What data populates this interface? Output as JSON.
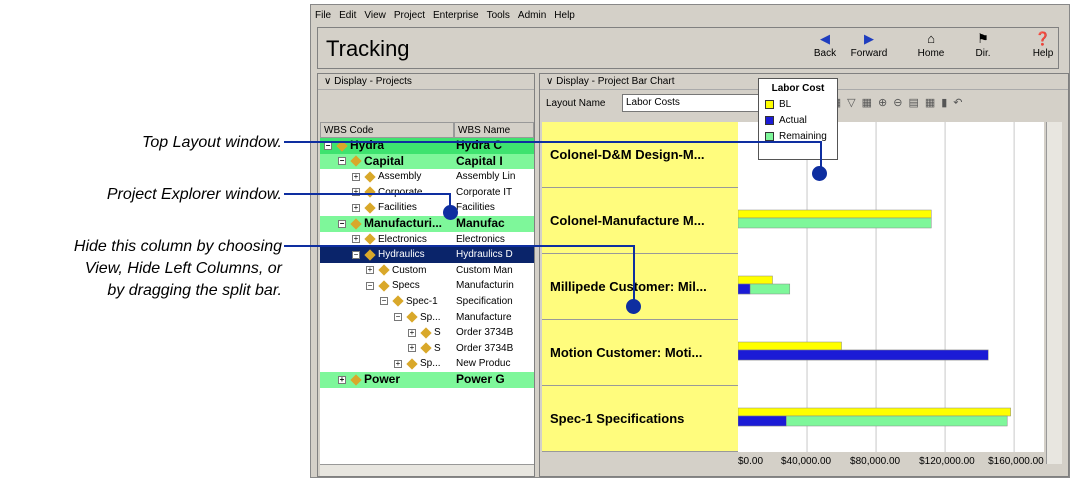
{
  "callouts": {
    "top_layout": "Top Layout window.",
    "project_explorer": "Project Explorer window.",
    "hide_line1": "Hide this column by choosing",
    "hide_line2": "View, Hide Left Columns, or",
    "hide_line3": "by dragging the split bar."
  },
  "menu": [
    "File",
    "Edit",
    "View",
    "Project",
    "Enterprise",
    "Tools",
    "Admin",
    "Help"
  ],
  "window_title": "Tracking",
  "toolbar": {
    "back": "Back",
    "forward": "Forward",
    "home": "Home",
    "dir": "Dir.",
    "help": "Help"
  },
  "left_pane": {
    "header": "Display - Projects",
    "col1": "WBS Code",
    "col2": "WBS Name",
    "rows": [
      {
        "code": "Hydra",
        "name": "Hydra C"
      },
      {
        "code": "Capital",
        "name": "Capital I"
      },
      {
        "code": "Assembly",
        "name": "Assembly Lin"
      },
      {
        "code": "Corporate",
        "name": "Corporate IT"
      },
      {
        "code": "Facilities",
        "name": "Facilities"
      },
      {
        "code": "Manufacturi...",
        "name": "Manufac"
      },
      {
        "code": "Electronics",
        "name": "Electronics"
      },
      {
        "code": "Hydraulics",
        "name": "Hydraulics D"
      },
      {
        "code": "Custom",
        "name": "Custom Man"
      },
      {
        "code": "Specs",
        "name": "Manufacturin"
      },
      {
        "code": "Spec-1",
        "name": "Specification"
      },
      {
        "code": "Sp...",
        "name": "Manufacture"
      },
      {
        "code": "S",
        "name": "Order 3734B"
      },
      {
        "code": "S",
        "name": "Order 3734B"
      },
      {
        "code": "Sp...",
        "name": "New Produc"
      },
      {
        "code": "Power",
        "name": "Power G"
      }
    ]
  },
  "right_pane": {
    "header": "Display - Project Bar Chart",
    "layout_label": "Layout Name",
    "layout_value": "Labor Costs"
  },
  "chart_data": {
    "type": "bar",
    "orientation": "horizontal",
    "categories": [
      "Colonel-D&M Design-M...",
      "Colonel-Manufacture M...",
      "Millipede Customer: Mil...",
      "Motion Customer: Moti...",
      "Spec-1 Specifications"
    ],
    "series": [
      {
        "name": "BL",
        "color": "#ffff00",
        "values": [
          0,
          112000,
          20000,
          60000,
          158000
        ]
      },
      {
        "name": "Actual",
        "color": "#1b1bd6",
        "values": [
          0,
          0,
          7000,
          145000,
          28000
        ]
      },
      {
        "name": "Remaining",
        "color": "#7ef79a",
        "values": [
          0,
          112000,
          30000,
          145000,
          156000
        ]
      }
    ],
    "legend_title": "Labor Cost",
    "x_ticks": [
      "$0.00",
      "$40,000.00",
      "$80,000.00",
      "$120,000.00",
      "$160,000.00"
    ],
    "xlim": [
      0,
      175000
    ],
    "legend_position": "top-right",
    "grid": true
  }
}
